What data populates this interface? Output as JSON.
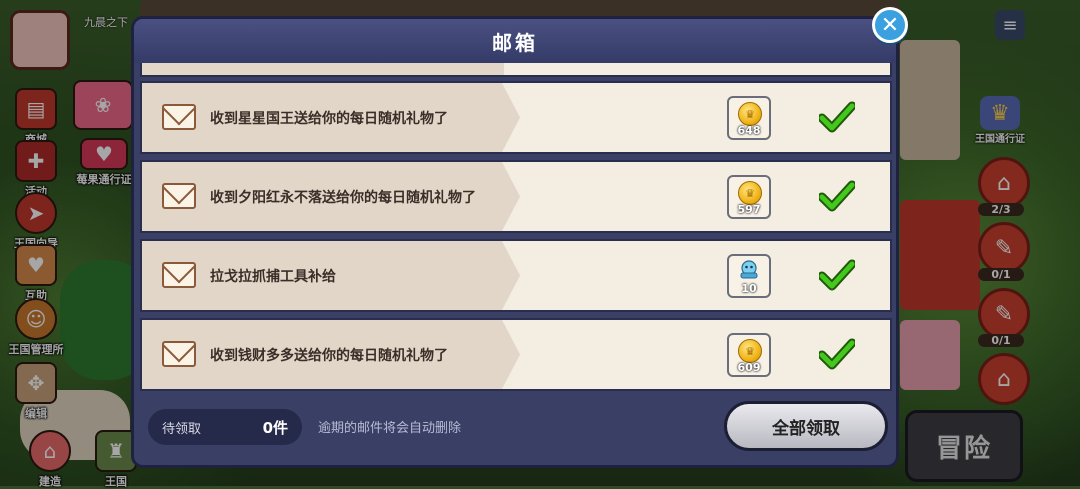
{
  "background": {
    "player_name": "九晨之下",
    "left_menu": [
      {
        "label": "商城",
        "icon": "shop-icon"
      },
      {
        "label": "莓果通行证",
        "icon": "berry-pass-icon"
      },
      {
        "label": "活动",
        "icon": "gift-icon"
      },
      {
        "label": "王国向导",
        "icon": "compass-icon"
      },
      {
        "label": "互助",
        "icon": "heart-icon"
      },
      {
        "label": "王国管理所",
        "icon": "cookie-icon"
      },
      {
        "label": "编辑",
        "icon": "edit-icon"
      },
      {
        "label": "建造",
        "icon": "build-icon"
      },
      {
        "label": "王国",
        "icon": "kingdom-icon"
      }
    ],
    "right_menu": {
      "kingdom_pass_label": "王国通行证",
      "counters": [
        "2/3",
        "0/1",
        "0/1"
      ]
    },
    "adventure_label": "冒险"
  },
  "mailbox": {
    "title": "邮箱",
    "messages": [
      {
        "text": "收到星星国王送给你的每日随机礼物了",
        "reward_icon": "coin-icon",
        "reward_qty": "648",
        "claimed": true
      },
      {
        "text": "收到夕阳红永不落送给你的每日随机礼物了",
        "reward_icon": "coin-icon",
        "reward_qty": "597",
        "claimed": true
      },
      {
        "text": "拉戈拉抓捕工具补给",
        "reward_icon": "capture-tool-icon",
        "reward_qty": "10",
        "claimed": true
      },
      {
        "text": "收到钱财多多送给你的每日随机礼物了",
        "reward_icon": "coin-icon",
        "reward_qty": "609",
        "claimed": true
      }
    ],
    "pending_label": "待领取",
    "pending_value": "0件",
    "expire_note": "逾期的邮件将会自动删除",
    "claim_all_label": "全部领取"
  },
  "colors": {
    "panel": "#3a3f66",
    "row_bg": "#f4ede2",
    "check_green": "#3fbf1f",
    "close_blue": "#3aa0e0"
  }
}
